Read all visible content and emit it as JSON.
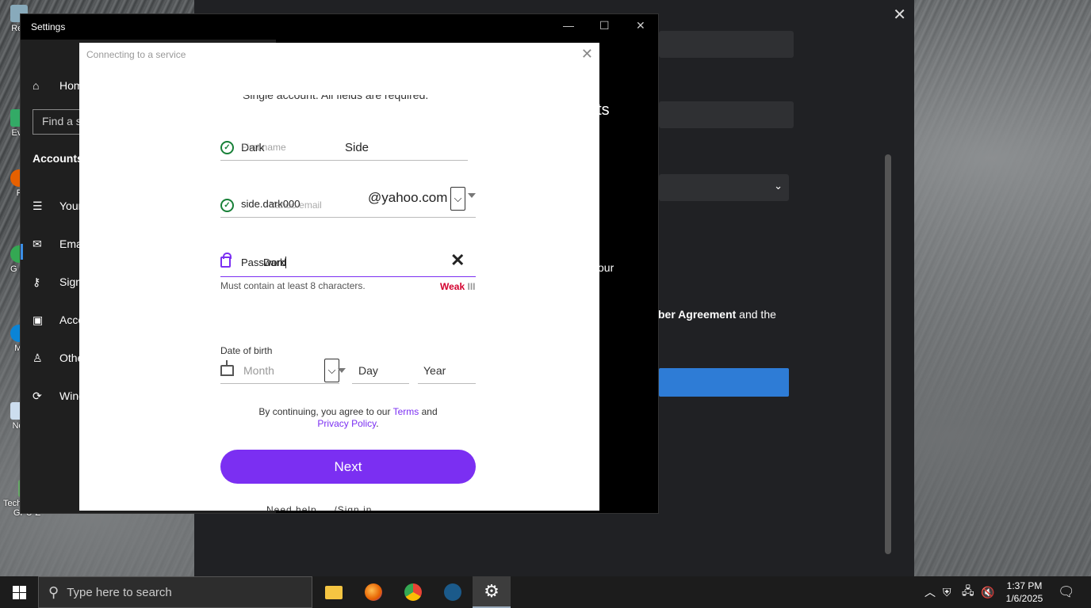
{
  "desktop": {
    "icons": [
      {
        "label": "Rec",
        "top": 0
      },
      {
        "label": "Eve",
        "top": 0
      },
      {
        "label": "F",
        "top": 0
      },
      {
        "label": "G Cl",
        "top": 0
      },
      {
        "label": "Mi",
        "top": 0
      },
      {
        "label": "Not",
        "top": 0
      },
      {
        "label": "TechPowe... GPU-Z",
        "top": 0
      }
    ]
  },
  "background_settings": {
    "heading_fragment": "acts",
    "text_fragment_1": "our",
    "text_fragment_2_bold": "ber Agreement",
    "text_fragment_2_rest": " and the"
  },
  "settings_window": {
    "title": "Settings",
    "controls": {
      "minimize": "—",
      "maximize": "☐",
      "close": "✕"
    },
    "home_label": "Hom",
    "search_placeholder": "Find a s",
    "section_title": "Accounts",
    "nav_items": [
      {
        "label": "Your",
        "icon": "person-list-icon"
      },
      {
        "label": "Emai",
        "icon": "mail-icon"
      },
      {
        "label": "Sign",
        "icon": "key-icon"
      },
      {
        "label": "Acce",
        "icon": "briefcase-icon"
      },
      {
        "label": "Othe",
        "icon": "person-icon"
      },
      {
        "label": "Wind",
        "icon": "sync-icon"
      }
    ]
  },
  "dialog": {
    "title": "Connecting to a service",
    "close": "✕",
    "subheading": "Single account. All fields are required.",
    "name_field": {
      "first_value": "Dark",
      "first_placeholder": "First name",
      "last_value": "Side"
    },
    "email_field": {
      "value": "side.dark000",
      "placeholder": "Yahoo email",
      "domain": "@yahoo.com"
    },
    "password_field": {
      "value": "Password",
      "typed": "Dark",
      "hint": "Must contain at least 8 characters.",
      "strength": "Weak"
    },
    "dob": {
      "label": "Date of birth",
      "month_placeholder": "Month",
      "day_placeholder": "Day",
      "year_placeholder": "Year"
    },
    "terms": {
      "prefix": "By continuing, you agree to our ",
      "terms_link": "Terms",
      "and": " and",
      "privacy_link": "Privacy Policy",
      "suffix": "."
    },
    "next_button": "Next",
    "cut_text": "Need help     ...  /Sign in"
  },
  "taskbar": {
    "search_placeholder": "Type here to search",
    "apps": [
      "file-explorer-icon",
      "firefox-icon",
      "chrome-icon",
      "steam-icon",
      "settings-gear-icon"
    ],
    "clock_time": "1:37 PM",
    "clock_date": "1/6/2025"
  },
  "colors": {
    "accent_purple": "#7b2ff2",
    "weak_red": "#d3002e",
    "check_green": "#188038",
    "win_blue": "#2e7cd6"
  }
}
